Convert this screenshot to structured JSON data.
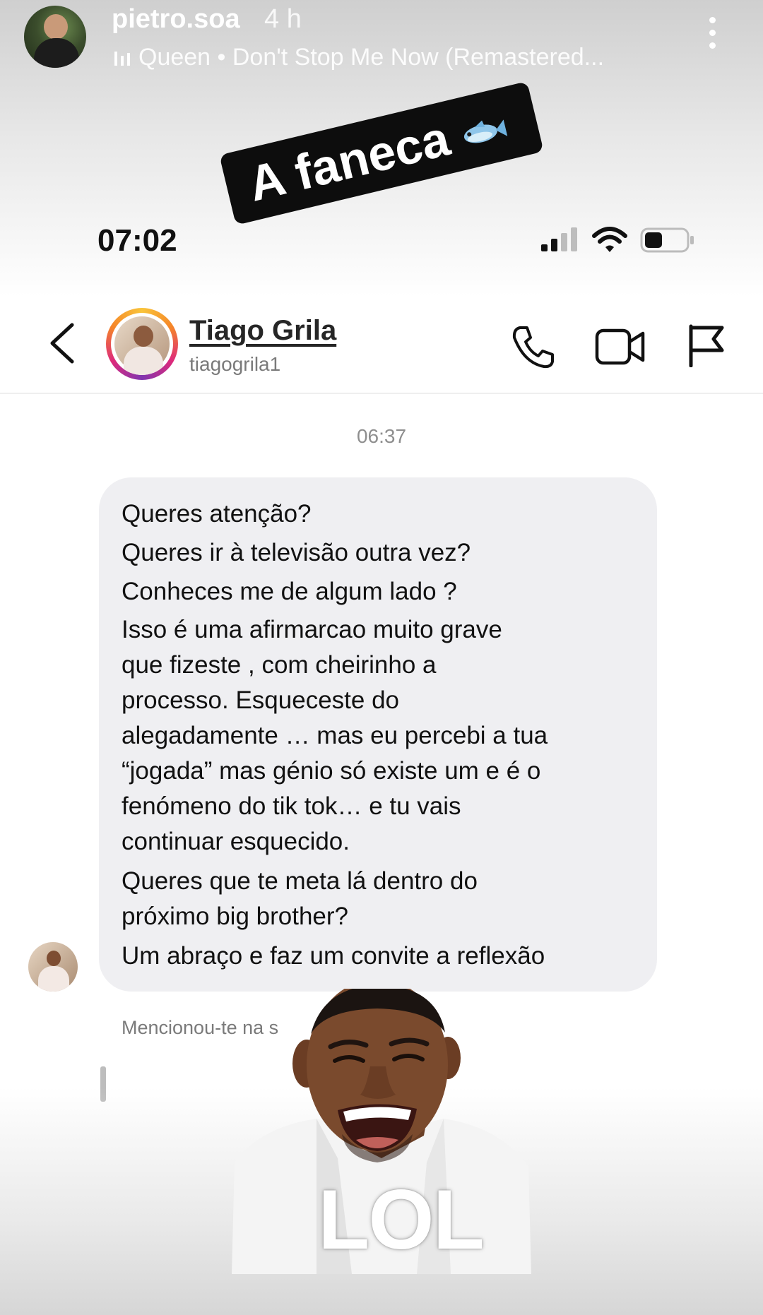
{
  "story": {
    "username": "pietro.soa",
    "time_ago": "4 h",
    "music": "Queen • Don't Stop Me Now (Remastered...",
    "sticker_text": "A faneca",
    "sticker_icon": "fish-icon",
    "gif_text": "LOL"
  },
  "status_bar": {
    "time": "07:02"
  },
  "dm": {
    "contact_name": "Tiago Grila",
    "contact_handle": "tiagogrila1",
    "timestamp": "06:37",
    "message_lines": [
      "Queres atenção?",
      "Queres ir à televisão outra vez?",
      "Conheces me de algum lado ?",
      "Isso é uma afirmarcao muito grave",
      "que fizeste , com cheirinho a",
      "processo. Esqueceste do",
      "alegadamente … mas eu percebi a tua",
      "“jogada” mas génio só existe um e é o",
      "fenómeno do tik tok… e tu vais",
      "continuar esquecido.",
      "Queres que te meta lá dentro do",
      "próximo big brother?",
      "Um abraço e faz um convite a reflexão"
    ],
    "mention_text": "Mencionou-te na s"
  }
}
